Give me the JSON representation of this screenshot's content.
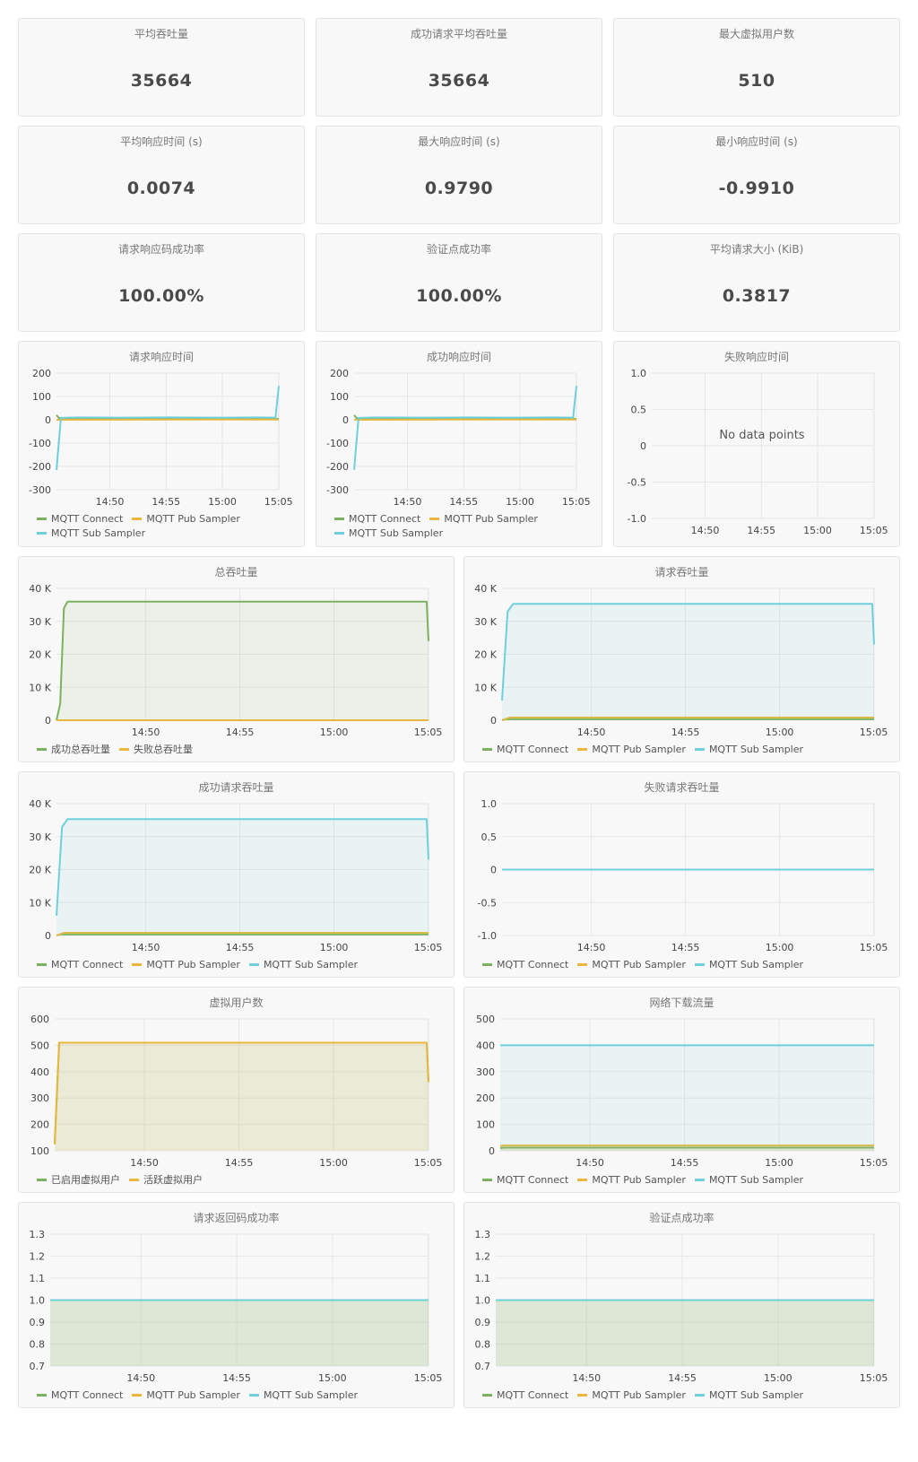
{
  "stats": [
    {
      "title": "平均吞吐量",
      "value": "35664"
    },
    {
      "title": "成功请求平均吞吐量",
      "value": "35664"
    },
    {
      "title": "最大虚拟用户数",
      "value": "510"
    },
    {
      "title": "平均响应时间 (s)",
      "value": "0.0074"
    },
    {
      "title": "最大响应时间 (s)",
      "value": "0.9790"
    },
    {
      "title": "最小响应时间 (s)",
      "value": "-0.9910"
    },
    {
      "title": "请求响应码成功率",
      "value": "100.00%"
    },
    {
      "title": "验证点成功率",
      "value": "100.00%"
    },
    {
      "title": "平均请求大小 (KiB)",
      "value": "0.3817"
    }
  ],
  "colors": {
    "green": "#7cb25f",
    "yellow": "#e9b73d",
    "cyan": "#6fcfdb",
    "grid": "#e6e6e6",
    "axis_text": "#444444"
  },
  "chart_data": [
    {
      "type": "line",
      "title": "请求响应时间",
      "x_ticks": [
        "14:50",
        "14:55",
        "15:00",
        "15:05"
      ],
      "y_ticks": [
        "200",
        "100",
        "0",
        "-100",
        "-200",
        "-300"
      ],
      "ylim": [
        -300,
        200
      ],
      "series": [
        {
          "name": "MQTT Connect",
          "color": "#7cb25f",
          "points": [
            [
              0,
              20
            ],
            [
              0.01,
              8
            ],
            [
              0.03,
              4
            ],
            [
              0.5,
              4
            ],
            [
              1,
              4
            ]
          ]
        },
        {
          "name": "MQTT Pub Sampler",
          "color": "#e9b73d",
          "points": [
            [
              0,
              0
            ],
            [
              0.5,
              1
            ],
            [
              1,
              1
            ]
          ]
        },
        {
          "name": "MQTT Sub Sampler",
          "color": "#6fcfdb",
          "points": [
            [
              0,
              -215
            ],
            [
              0.02,
              8
            ],
            [
              0.1,
              10
            ],
            [
              0.3,
              9
            ],
            [
              0.5,
              10
            ],
            [
              0.7,
              9
            ],
            [
              0.9,
              10
            ],
            [
              0.985,
              9
            ],
            [
              1,
              145
            ]
          ]
        }
      ],
      "legend": [
        "MQTT Connect",
        "MQTT Pub Sampler",
        "MQTT Sub Sampler"
      ]
    },
    {
      "type": "line",
      "title": "成功响应时间",
      "x_ticks": [
        "14:50",
        "14:55",
        "15:00",
        "15:05"
      ],
      "y_ticks": [
        "200",
        "100",
        "0",
        "-100",
        "-200",
        "-300"
      ],
      "ylim": [
        -300,
        200
      ],
      "series": [
        {
          "name": "MQTT Connect",
          "color": "#7cb25f",
          "points": [
            [
              0,
              20
            ],
            [
              0.01,
              8
            ],
            [
              0.03,
              4
            ],
            [
              0.5,
              4
            ],
            [
              1,
              4
            ]
          ]
        },
        {
          "name": "MQTT Pub Sampler",
          "color": "#e9b73d",
          "points": [
            [
              0,
              0
            ],
            [
              0.5,
              1
            ],
            [
              1,
              1
            ]
          ]
        },
        {
          "name": "MQTT Sub Sampler",
          "color": "#6fcfdb",
          "points": [
            [
              0,
              -215
            ],
            [
              0.02,
              8
            ],
            [
              0.1,
              10
            ],
            [
              0.3,
              9
            ],
            [
              0.5,
              10
            ],
            [
              0.7,
              9
            ],
            [
              0.9,
              10
            ],
            [
              0.985,
              9
            ],
            [
              1,
              145
            ]
          ]
        }
      ],
      "legend": [
        "MQTT Connect",
        "MQTT Pub Sampler",
        "MQTT Sub Sampler"
      ]
    },
    {
      "type": "line",
      "title": "失败响应时间",
      "x_ticks": [
        "14:50",
        "14:55",
        "15:00",
        "15:05"
      ],
      "y_ticks": [
        "1.0",
        "0.5",
        "0",
        "-0.5",
        "-1.0"
      ],
      "ylim": [
        -1,
        1
      ],
      "series": [],
      "no_data": "No data points",
      "legend": []
    },
    {
      "type": "area",
      "title": "总吞吐量",
      "x_ticks": [
        "14:50",
        "14:55",
        "15:00",
        "15:05"
      ],
      "y_ticks": [
        "40 K",
        "30 K",
        "20 K",
        "10 K",
        "0"
      ],
      "ylim": [
        0,
        40000
      ],
      "series": [
        {
          "name": "成功总吞吐量",
          "color": "#7cb25f",
          "points": [
            [
              0,
              0
            ],
            [
              0.01,
              5000
            ],
            [
              0.02,
              34000
            ],
            [
              0.03,
              36000
            ],
            [
              0.5,
              36000
            ],
            [
              0.98,
              36000
            ],
            [
              0.995,
              36000
            ],
            [
              1,
              24000
            ]
          ]
        },
        {
          "name": "失败总吞吐量",
          "color": "#e9b73d",
          "points": [
            [
              0,
              0
            ],
            [
              1,
              0
            ]
          ]
        }
      ],
      "legend": [
        "成功总吞吐量",
        "失败总吞吐量"
      ]
    },
    {
      "type": "area",
      "title": "请求吞吐量",
      "x_ticks": [
        "14:50",
        "14:55",
        "15:00",
        "15:05"
      ],
      "y_ticks": [
        "40 K",
        "30 K",
        "20 K",
        "10 K",
        "0"
      ],
      "ylim": [
        0,
        40000
      ],
      "series": [
        {
          "name": "MQTT Connect",
          "color": "#7cb25f",
          "points": [
            [
              0,
              0
            ],
            [
              0.01,
              300
            ],
            [
              1,
              300
            ]
          ]
        },
        {
          "name": "MQTT Pub Sampler",
          "color": "#e9b73d",
          "points": [
            [
              0,
              0
            ],
            [
              0.02,
              800
            ],
            [
              1,
              800
            ]
          ]
        },
        {
          "name": "MQTT Sub Sampler",
          "color": "#6fcfdb",
          "points": [
            [
              0,
              6000
            ],
            [
              0.015,
              33000
            ],
            [
              0.03,
              35300
            ],
            [
              0.5,
              35300
            ],
            [
              0.995,
              35300
            ],
            [
              1,
              23000
            ]
          ]
        }
      ],
      "legend": [
        "MQTT Connect",
        "MQTT Pub Sampler",
        "MQTT Sub Sampler"
      ]
    },
    {
      "type": "area",
      "title": "成功请求吞吐量",
      "x_ticks": [
        "14:50",
        "14:55",
        "15:00",
        "15:05"
      ],
      "y_ticks": [
        "40 K",
        "30 K",
        "20 K",
        "10 K",
        "0"
      ],
      "ylim": [
        0,
        40000
      ],
      "series": [
        {
          "name": "MQTT Connect",
          "color": "#7cb25f",
          "points": [
            [
              0,
              0
            ],
            [
              0.01,
              300
            ],
            [
              1,
              300
            ]
          ]
        },
        {
          "name": "MQTT Pub Sampler",
          "color": "#e9b73d",
          "points": [
            [
              0,
              0
            ],
            [
              0.02,
              800
            ],
            [
              1,
              800
            ]
          ]
        },
        {
          "name": "MQTT Sub Sampler",
          "color": "#6fcfdb",
          "points": [
            [
              0,
              6000
            ],
            [
              0.015,
              33000
            ],
            [
              0.03,
              35300
            ],
            [
              0.5,
              35300
            ],
            [
              0.995,
              35300
            ],
            [
              1,
              23000
            ]
          ]
        }
      ],
      "legend": [
        "MQTT Connect",
        "MQTT Pub Sampler",
        "MQTT Sub Sampler"
      ]
    },
    {
      "type": "line",
      "title": "失败请求吞吐量",
      "x_ticks": [
        "14:50",
        "14:55",
        "15:00",
        "15:05"
      ],
      "y_ticks": [
        "1.0",
        "0.5",
        "0",
        "-0.5",
        "-1.0"
      ],
      "ylim": [
        -1,
        1
      ],
      "series": [
        {
          "name": "MQTT Connect",
          "color": "#7cb25f",
          "points": [
            [
              0,
              0
            ],
            [
              1,
              0
            ]
          ]
        },
        {
          "name": "MQTT Pub Sampler",
          "color": "#e9b73d",
          "points": [
            [
              0,
              0
            ],
            [
              1,
              0
            ]
          ]
        },
        {
          "name": "MQTT Sub Sampler",
          "color": "#6fcfdb",
          "points": [
            [
              0,
              0
            ],
            [
              1,
              0
            ]
          ]
        }
      ],
      "legend": [
        "MQTT Connect",
        "MQTT Pub Sampler",
        "MQTT Sub Sampler"
      ]
    },
    {
      "type": "area",
      "title": "虚拟用户数",
      "x_ticks": [
        "14:50",
        "14:55",
        "15:00",
        "15:05"
      ],
      "y_ticks": [
        "600",
        "500",
        "400",
        "300",
        "200",
        "100"
      ],
      "ylim": [
        100,
        600
      ],
      "series": [
        {
          "name": "已启用虚拟用户",
          "color": "#7cb25f",
          "points": [
            [
              0,
              125
            ],
            [
              0.012,
              510
            ],
            [
              0.5,
              510
            ],
            [
              0.995,
              510
            ],
            [
              1,
              360
            ]
          ]
        },
        {
          "name": "活跃虚拟用户",
          "color": "#e9b73d",
          "points": [
            [
              0,
              125
            ],
            [
              0.012,
              510
            ],
            [
              0.5,
              510
            ],
            [
              0.995,
              510
            ],
            [
              1,
              360
            ]
          ]
        }
      ],
      "legend": [
        "已启用虚拟用户",
        "活跃虚拟用户"
      ]
    },
    {
      "type": "area",
      "title": "网络下载流量",
      "x_ticks": [
        "14:50",
        "14:55",
        "15:00",
        "15:05"
      ],
      "y_ticks": [
        "500",
        "400",
        "300",
        "200",
        "100",
        "0"
      ],
      "ylim": [
        0,
        500
      ],
      "series": [
        {
          "name": "MQTT Connect",
          "color": "#7cb25f",
          "points": [
            [
              0,
              10
            ],
            [
              0.01,
              12
            ],
            [
              1,
              12
            ]
          ]
        },
        {
          "name": "MQTT Pub Sampler",
          "color": "#e9b73d",
          "points": [
            [
              0,
              18
            ],
            [
              0.01,
              20
            ],
            [
              1,
              20
            ]
          ]
        },
        {
          "name": "MQTT Sub Sampler",
          "color": "#6fcfdb",
          "points": [
            [
              0,
              400
            ],
            [
              1,
              400
            ]
          ]
        }
      ],
      "legend": [
        "MQTT Connect",
        "MQTT Pub Sampler",
        "MQTT Sub Sampler"
      ]
    },
    {
      "type": "area",
      "title": "请求返回码成功率",
      "x_ticks": [
        "14:50",
        "14:55",
        "15:00",
        "15:05"
      ],
      "y_ticks": [
        "1.3",
        "1.2",
        "1.1",
        "1.0",
        "0.9",
        "0.8",
        "0.7"
      ],
      "ylim": [
        0.7,
        1.3
      ],
      "series": [
        {
          "name": "MQTT Connect",
          "color": "#7cb25f",
          "points": [
            [
              0,
              1
            ],
            [
              1,
              1
            ]
          ]
        },
        {
          "name": "MQTT Pub Sampler",
          "color": "#e9b73d",
          "points": [
            [
              0,
              1
            ],
            [
              1,
              1
            ]
          ]
        },
        {
          "name": "MQTT Sub Sampler",
          "color": "#6fcfdb",
          "points": [
            [
              0,
              1
            ],
            [
              1,
              1
            ]
          ]
        }
      ],
      "legend": [
        "MQTT Connect",
        "MQTT Pub Sampler",
        "MQTT Sub Sampler"
      ]
    },
    {
      "type": "area",
      "title": "验证点成功率",
      "x_ticks": [
        "14:50",
        "14:55",
        "15:00",
        "15:05"
      ],
      "y_ticks": [
        "1.3",
        "1.2",
        "1.1",
        "1.0",
        "0.9",
        "0.8",
        "0.7"
      ],
      "ylim": [
        0.7,
        1.3
      ],
      "series": [
        {
          "name": "MQTT Connect",
          "color": "#7cb25f",
          "points": [
            [
              0,
              1
            ],
            [
              1,
              1
            ]
          ]
        },
        {
          "name": "MQTT Pub Sampler",
          "color": "#e9b73d",
          "points": [
            [
              0,
              1
            ],
            [
              1,
              1
            ]
          ]
        },
        {
          "name": "MQTT Sub Sampler",
          "color": "#6fcfdb",
          "points": [
            [
              0,
              1
            ],
            [
              1,
              1
            ]
          ]
        }
      ],
      "legend": [
        "MQTT Connect",
        "MQTT Pub Sampler",
        "MQTT Sub Sampler"
      ]
    }
  ]
}
